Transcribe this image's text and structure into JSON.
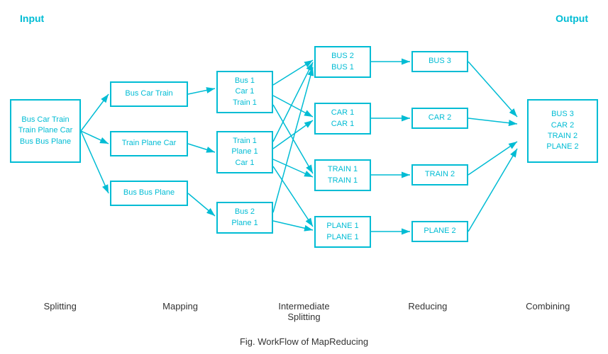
{
  "title": "Fig. WorkFlow of MapReducing",
  "labels": {
    "input": "Input",
    "output": "Output",
    "splitting": "Splitting",
    "mapping": "Mapping",
    "intermediate_splitting": "Intermediate\nSplitting",
    "reducing": "Reducing",
    "combining": "Combining"
  },
  "boxes": {
    "input": "Bus Car Train\nTrain Plane Car\nBus Bus Plane",
    "split1": "Bus Car Train",
    "split2": "Train Plane Car",
    "split3": "Bus Bus Plane",
    "map1": "Bus 1\nCar 1\nTrain 1",
    "map2": "Train 1\nPlane 1\nCar 1",
    "map3": "Bus 2\nPlane 1",
    "inter1": "BUS 2\nBUS 1",
    "inter2": "CAR 1\nCAR 1",
    "inter3": "TRAIN 1\nTRAIN 1",
    "inter4": "PLANE 1\nPLANE 1",
    "reduce1": "BUS 3",
    "reduce2": "CAR 2",
    "reduce3": "TRAIN 2",
    "reduce4": "PLANE 2",
    "output": "BUS 3\nCAR 2\nTRAIN 2\nPLANE 2"
  }
}
